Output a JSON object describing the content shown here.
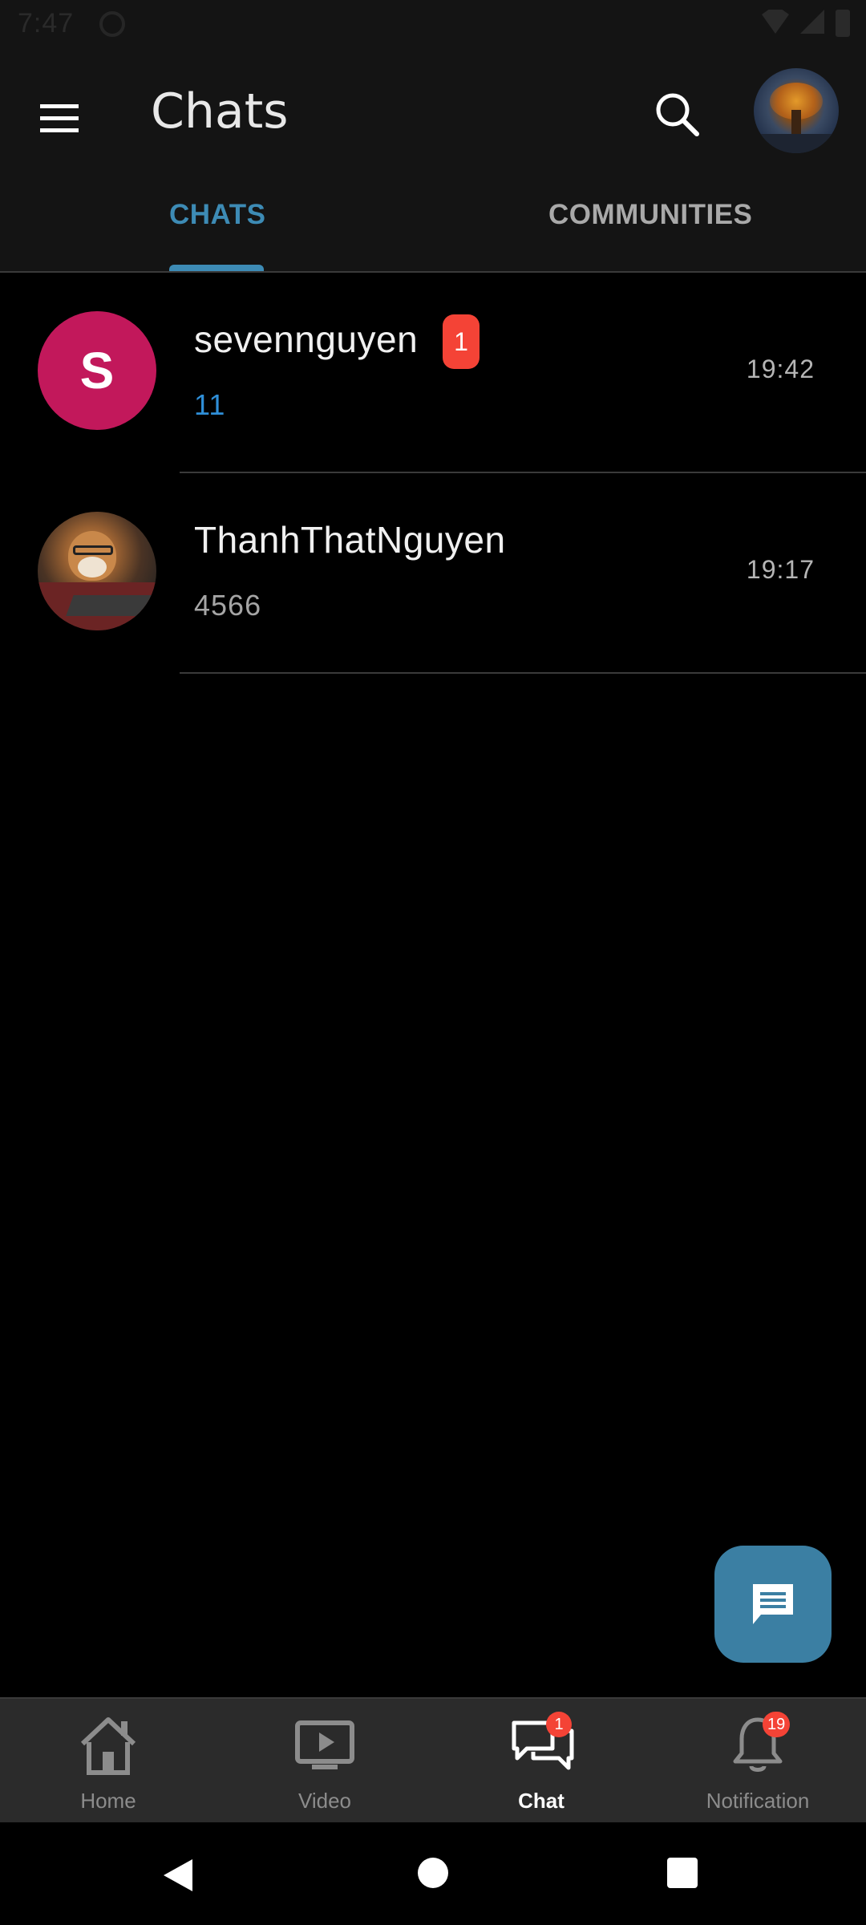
{
  "status_bar": {
    "time": "7:47"
  },
  "app_bar": {
    "title": "Chats"
  },
  "tabs": [
    {
      "label": "CHATS",
      "active": true
    },
    {
      "label": "COMMUNITIES",
      "active": false
    }
  ],
  "chats": [
    {
      "name": "sevennguyen",
      "avatar_letter": "S",
      "avatar_color": "#c2185b",
      "unread_count": "1",
      "preview": "11",
      "time": "19:42"
    },
    {
      "name": "ThanhThatNguyen",
      "preview": "4566",
      "time": "19:17"
    }
  ],
  "bottom_nav": {
    "items": [
      {
        "label": "Home",
        "icon": "home-icon"
      },
      {
        "label": "Video",
        "icon": "video-icon"
      },
      {
        "label": "Chat",
        "icon": "chat-icon",
        "badge": "1",
        "active": true
      },
      {
        "label": "Notification",
        "icon": "bell-icon",
        "badge": "19"
      }
    ]
  },
  "colors": {
    "accent": "#3d8bb5",
    "fab": "#3b7fa3",
    "badge": "#f44336",
    "background": "#000000",
    "bar": "#141414"
  }
}
